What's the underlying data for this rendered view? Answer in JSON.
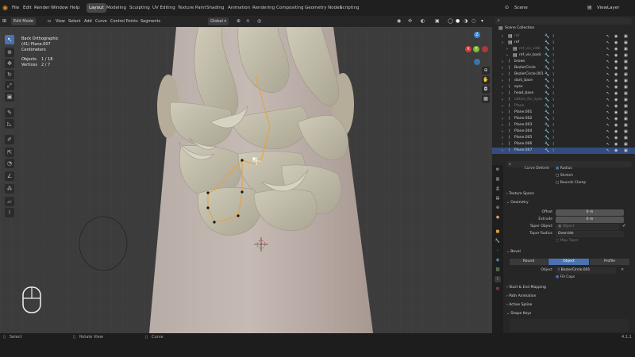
{
  "menu": {
    "items": [
      "File",
      "Edit",
      "Render",
      "Window",
      "Help"
    ]
  },
  "workspaces": [
    {
      "label": "Layout",
      "active": true
    },
    {
      "label": "Modeling",
      "active": false
    },
    {
      "label": "Sculpting",
      "active": false
    },
    {
      "label": "UV Editing",
      "active": false
    },
    {
      "label": "Texture Paint",
      "active": false
    },
    {
      "label": "Shading",
      "active": false
    },
    {
      "label": "Animation",
      "active": false
    },
    {
      "label": "Rendering",
      "active": false
    },
    {
      "label": "Compositing",
      "active": false
    },
    {
      "label": "Geometry Nodes",
      "active": false
    },
    {
      "label": "Scripting",
      "active": false
    }
  ],
  "scene": {
    "label": "Scene",
    "view_layer": "ViewLayer"
  },
  "header": {
    "mode": "Edit Mode",
    "menus": [
      "View",
      "Select",
      "Add",
      "Curve",
      "Control Points",
      "Segments"
    ],
    "orientation": "Global"
  },
  "viewport_info": {
    "view": "Back Orthographic",
    "object": "(41) Plane.007",
    "unit": "Centimeters",
    "objects_label": "Objects",
    "objects_value": "1 / 18",
    "vertices_label": "Vertices",
    "vertices_value": "2 / 7"
  },
  "gizmo": {
    "axes": [
      "X",
      "Y",
      "Z"
    ]
  },
  "outliner": {
    "search_placeholder": "",
    "title": "Scene Collection",
    "rows": [
      {
        "name": "ref",
        "indent": 1,
        "dim": true
      },
      {
        "name": "ref",
        "indent": 1,
        "dim": false
      },
      {
        "name": "ref_viv_side",
        "indent": 2,
        "dim": true
      },
      {
        "name": "ref_viv_back",
        "indent": 2,
        "dim": false
      },
      {
        "name": "brows",
        "indent": 1,
        "dim": false
      },
      {
        "name": "BezierCircle",
        "indent": 1,
        "dim": false
      },
      {
        "name": "BezierCircle.001",
        "indent": 1,
        "dim": false
      },
      {
        "name": "dark_base",
        "indent": 1,
        "dim": false
      },
      {
        "name": "eyes",
        "indent": 1,
        "dim": false
      },
      {
        "name": "head_base",
        "indent": 1,
        "dim": false
      },
      {
        "name": "lattice_for_eyes",
        "indent": 1,
        "dim": true
      },
      {
        "name": "Plane",
        "indent": 1,
        "dim": true
      },
      {
        "name": "Plane.001",
        "indent": 1,
        "dim": false
      },
      {
        "name": "Plane.002",
        "indent": 1,
        "dim": false
      },
      {
        "name": "Plane.003",
        "indent": 1,
        "dim": false
      },
      {
        "name": "Plane.004",
        "indent": 1,
        "dim": false
      },
      {
        "name": "Plane.005",
        "indent": 1,
        "dim": false
      },
      {
        "name": "Plane.006",
        "indent": 1,
        "dim": false
      },
      {
        "name": "Plane.007",
        "indent": 1,
        "dim": false,
        "selected": true
      }
    ]
  },
  "properties": {
    "curve_deform_label": "Curve Deform",
    "radius_label": "Radius",
    "stretch_label": "Stretch",
    "bounds_clamp_label": "Bounds Clamp",
    "texture_space": "Texture Space",
    "geometry": "Geometry",
    "offset_label": "Offset",
    "offset_value": "0 m",
    "extrude_label": "Extrude",
    "extrude_value": "0 m",
    "taper_object_label": "Taper Object",
    "taper_object_placeholder": "Object",
    "taper_radius_label": "Taper Radius",
    "taper_radius_value": "Override",
    "map_taper": "Map Taper",
    "bevel": "Bevel",
    "bevel_modes": [
      "Round",
      "Object",
      "Profile"
    ],
    "bevel_active": "Object",
    "object_label": "Object",
    "object_value": "BezierCircle.001",
    "fill_caps": "Fill Caps",
    "start_end": "Start & End Mapping",
    "path_animation": "Path Animation",
    "active_spline": "Active Spline",
    "shape_keys": "Shape Keys"
  },
  "status": {
    "select": "Select",
    "rotate": "Rotate View",
    "object": "Curve",
    "version": "4.1.1"
  },
  "colors": {
    "accent": "#4a72b0",
    "curve": "#e8a13a",
    "selected_row": "#334d80"
  }
}
